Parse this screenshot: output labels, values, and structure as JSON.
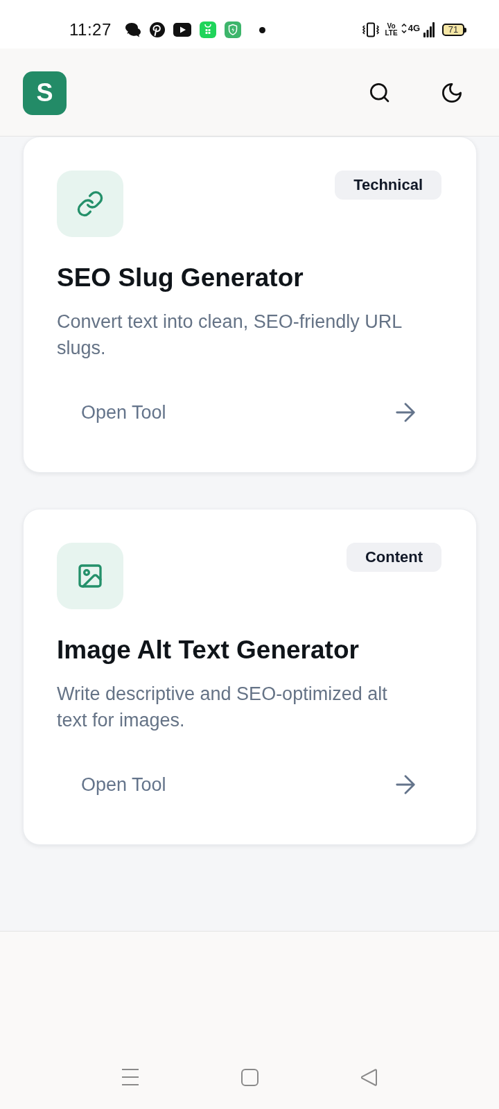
{
  "status_bar": {
    "time": "11:27",
    "volte_top": "Vo",
    "volte_bottom": "LTE",
    "network": "4G",
    "battery": "71"
  },
  "header": {
    "logo": "S"
  },
  "cards": [
    {
      "badge": "Technical",
      "title": "SEO Slug Generator",
      "description": "Convert text into clean, SEO-friendly URL slugs.",
      "action": "Open Tool"
    },
    {
      "badge": "Content",
      "title": "Image Alt Text Generator",
      "description": "Write descriptive and SEO-optimized alt text for images.",
      "action": "Open Tool"
    }
  ]
}
